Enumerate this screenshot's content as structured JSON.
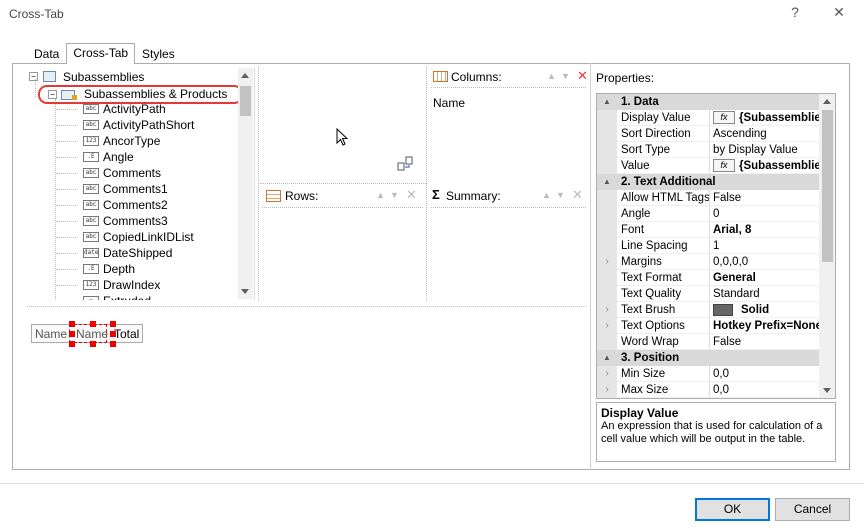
{
  "window": {
    "title": "Cross-Tab",
    "help_glyph": "?",
    "close_glyph": "✕"
  },
  "tabs": [
    {
      "label": "Data"
    },
    {
      "label": "Cross-Tab"
    },
    {
      "label": "Styles"
    }
  ],
  "tree": {
    "root": {
      "label": "Subassemblies",
      "toggle": "−"
    },
    "selected": {
      "label": "Subassemblies & Products",
      "toggle": "−"
    },
    "fields": [
      {
        "type": "abc",
        "label": "ActivityPath"
      },
      {
        "type": "abc",
        "label": "ActivityPathShort"
      },
      {
        "type": "123",
        "label": "AncorType"
      },
      {
        "type": ".E",
        "label": "Angle"
      },
      {
        "type": "abc",
        "label": "Comments"
      },
      {
        "type": "abc",
        "label": "Comments1"
      },
      {
        "type": "abc",
        "label": "Comments2"
      },
      {
        "type": "abc",
        "label": "Comments3"
      },
      {
        "type": "abc",
        "label": "CopiedLinkIDList"
      },
      {
        "type": "date",
        "label": "DateShipped"
      },
      {
        "type": ".E",
        "label": "Depth"
      },
      {
        "type": "123",
        "label": "DrawIndex"
      },
      {
        "type": "☑",
        "label": "Extruded"
      }
    ]
  },
  "panes": {
    "columns": {
      "label": "Columns:",
      "items": [
        "Name"
      ]
    },
    "rows": {
      "label": "Rows:"
    },
    "summary": {
      "label": "Summary:",
      "sigma": "Σ"
    }
  },
  "preview": {
    "cells": [
      "Name",
      "Name",
      "Total"
    ]
  },
  "properties": {
    "label": "Properties:",
    "rows": [
      {
        "kind": "cat",
        "toggle": "▲",
        "label": "1. Data"
      },
      {
        "kind": "prop",
        "name": "Display Value",
        "value": "{Subassemblie",
        "fx": true,
        "bold": true
      },
      {
        "kind": "prop",
        "name": "Sort Direction",
        "value": "Ascending"
      },
      {
        "kind": "prop",
        "name": "Sort Type",
        "value": "by Display Value"
      },
      {
        "kind": "prop",
        "name": "Value",
        "value": "{Subassemblie",
        "fx": true,
        "bold": true
      },
      {
        "kind": "cat",
        "toggle": "▲",
        "label": "2. Text Additional"
      },
      {
        "kind": "prop",
        "name": "Allow HTML Tags",
        "value": "False"
      },
      {
        "kind": "prop",
        "name": "Angle",
        "value": "0"
      },
      {
        "kind": "prop",
        "name": "Font",
        "value": "Arial, 8",
        "bold": true
      },
      {
        "kind": "prop",
        "name": "Line Spacing",
        "value": "1"
      },
      {
        "kind": "prop",
        "name": "Margins",
        "value": "0,0,0,0",
        "expand": true
      },
      {
        "kind": "prop",
        "name": "Text Format",
        "value": "General",
        "bold": true
      },
      {
        "kind": "prop",
        "name": "Text Quality",
        "value": "Standard"
      },
      {
        "kind": "prop",
        "name": "Text Brush",
        "value": "Solid",
        "swatch": true,
        "bold": true,
        "expand": true
      },
      {
        "kind": "prop",
        "name": "Text Options",
        "value": "Hotkey Prefix=None",
        "bold": true,
        "expand": true
      },
      {
        "kind": "prop",
        "name": "Word Wrap",
        "value": "False"
      },
      {
        "kind": "cat",
        "toggle": "▲",
        "label": "3. Position"
      },
      {
        "kind": "prop",
        "name": "Min Size",
        "value": "0,0",
        "expand": true
      },
      {
        "kind": "prop",
        "name": "Max Size",
        "value": "0,0",
        "expand": true
      }
    ],
    "description": {
      "title": "Display Value",
      "text": "An expression that is used for calculation of a cell value which will be output in the table."
    }
  },
  "buttons": {
    "ok": "OK",
    "cancel": "Cancel"
  },
  "colors": {
    "highlight_ring": "#e53935",
    "selection_handle": "#ee0000",
    "accent": "#0078d7"
  }
}
